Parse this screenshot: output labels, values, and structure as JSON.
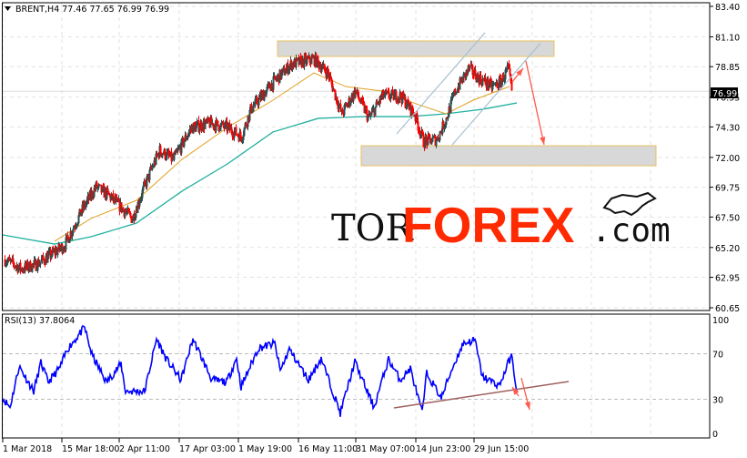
{
  "header": {
    "symbol_label": "BRENT,H4 77.46 77.65 76.99 76.99"
  },
  "rsi_header": {
    "label": "RSI(13) 37.8064"
  },
  "logo": {
    "tor": "TOR",
    "forex": "FOREX",
    "com": ".com"
  },
  "colors": {
    "bull": "#2f4f4f",
    "bear": "#ff0000",
    "ma_fast": "#e0a020",
    "ma_slow": "#20b0a0",
    "rsi": "#0000ff",
    "arrow": "#ff5a4a",
    "zone_border": "#e8c060",
    "zone_fill": "#d8d8d8",
    "channel": "#a8c0d0",
    "rsi_trend": "#a06060"
  },
  "chart_data": {
    "type": "candlestick",
    "symbol": "BRENT",
    "timeframe": "H4",
    "ohlc_last": {
      "open": 77.46,
      "high": 77.65,
      "low": 76.99,
      "close": 76.99
    },
    "current_price_label": "76.99",
    "y_ticks": [
      "83.40",
      "81.10",
      "78.85",
      "76.55",
      "74.30",
      "72.00",
      "69.75",
      "67.50",
      "65.20",
      "62.95",
      "60.65"
    ],
    "y_tick_values": [
      83.4,
      81.1,
      78.85,
      76.55,
      74.3,
      72.0,
      69.75,
      67.5,
      65.2,
      62.95,
      60.65
    ],
    "ylim": [
      60.65,
      83.4
    ],
    "x_ticks": [
      {
        "bar": 0,
        "label": "1 Mar 2018"
      },
      {
        "bar": 65,
        "label": "15 Mar 18:00"
      },
      {
        "bar": 128,
        "label": "2 Apr 11:00"
      },
      {
        "bar": 194,
        "label": "17 Apr 03:00"
      },
      {
        "bar": 259,
        "label": "1 May 19:00"
      },
      {
        "bar": 325,
        "label": "16 May 11:00"
      },
      {
        "bar": 388,
        "label": "31 May 07:00"
      },
      {
        "bar": 454,
        "label": "14 Jun 23:00"
      },
      {
        "bar": 518,
        "label": "29 Jun 15:00"
      }
    ],
    "price_path": [
      [
        2,
        64.3
      ],
      [
        20,
        63.6
      ],
      [
        37,
        63.95
      ],
      [
        67,
        65.33
      ],
      [
        87,
        68.07
      ],
      [
        102,
        69.79
      ],
      [
        117,
        69.1
      ],
      [
        142,
        67.39
      ],
      [
        157,
        70.14
      ],
      [
        172,
        72.54
      ],
      [
        187,
        71.85
      ],
      [
        207,
        74.26
      ],
      [
        227,
        74.6
      ],
      [
        247,
        74.26
      ],
      [
        262,
        73.57
      ],
      [
        272,
        75.63
      ],
      [
        297,
        77.7
      ],
      [
        317,
        79.07
      ],
      [
        342,
        79.41
      ],
      [
        357,
        78.38
      ],
      [
        372,
        75.29
      ],
      [
        387,
        77.01
      ],
      [
        402,
        74.95
      ],
      [
        417,
        76.66
      ],
      [
        437,
        76.66
      ],
      [
        452,
        75.29
      ],
      [
        462,
        73.2
      ],
      [
        477,
        73.4
      ],
      [
        487,
        74.95
      ],
      [
        497,
        77.01
      ],
      [
        512,
        78.73
      ],
      [
        522,
        78.04
      ],
      [
        537,
        77.35
      ],
      [
        547,
        77.7
      ],
      [
        555,
        78.73
      ],
      [
        559,
        76.99
      ]
    ],
    "ma_fast": [
      [
        57,
        65.67
      ],
      [
        97,
        67.39
      ],
      [
        147,
        68.76
      ],
      [
        197,
        71.85
      ],
      [
        247,
        74.26
      ],
      [
        297,
        76.32
      ],
      [
        342,
        78.38
      ],
      [
        377,
        77.35
      ],
      [
        417,
        77.01
      ],
      [
        457,
        75.98
      ],
      [
        487,
        75.29
      ],
      [
        517,
        76.32
      ],
      [
        557,
        77.35
      ]
    ],
    "ma_slow": [
      [
        0,
        66.15
      ],
      [
        57,
        65.46
      ],
      [
        97,
        66.01
      ],
      [
        147,
        67.04
      ],
      [
        197,
        69.45
      ],
      [
        247,
        71.51
      ],
      [
        297,
        73.92
      ],
      [
        347,
        74.95
      ],
      [
        397,
        75.08
      ],
      [
        447,
        75.08
      ],
      [
        487,
        75.29
      ],
      [
        527,
        75.63
      ],
      [
        565,
        76.11
      ]
    ],
    "zones": [
      {
        "from_bar": 302,
        "to_bar": 606,
        "top": 80.79,
        "bottom": 79.62
      },
      {
        "from_bar": 394,
        "to_bar": 718,
        "top": 72.88,
        "bottom": 71.37
      }
    ],
    "channel": [
      [
        [
          433,
          73.78
        ],
        [
          530,
          81.41
        ]
      ],
      [
        [
          494,
          72.95
        ],
        [
          591,
          80.62
        ]
      ]
    ],
    "arrows": [
      [
        [
          560,
          77.7
        ],
        [
          572,
          78.73
        ]
      ],
      [
        [
          575,
          79.28
        ],
        [
          595,
          72.95
        ]
      ]
    ],
    "rsi": {
      "period": 13,
      "last": 37.8064,
      "ylim": [
        0,
        100
      ],
      "levels": [
        30,
        70
      ],
      "y_ticks": [
        "100",
        "70",
        "30",
        "0"
      ],
      "y_tick_values": [
        100,
        70,
        30,
        0
      ],
      "path": [
        [
          0,
          31
        ],
        [
          8,
          23
        ],
        [
          18,
          59
        ],
        [
          34,
          37
        ],
        [
          42,
          62
        ],
        [
          50,
          45
        ],
        [
          63,
          58
        ],
        [
          71,
          74
        ],
        [
          90,
          93
        ],
        [
          98,
          69
        ],
        [
          114,
          45
        ],
        [
          130,
          61
        ],
        [
          135,
          37
        ],
        [
          156,
          37
        ],
        [
          169,
          83
        ],
        [
          180,
          65
        ],
        [
          196,
          47
        ],
        [
          209,
          83
        ],
        [
          230,
          47
        ],
        [
          246,
          45
        ],
        [
          257,
          66
        ],
        [
          262,
          41
        ],
        [
          281,
          75
        ],
        [
          299,
          79
        ],
        [
          305,
          55
        ],
        [
          315,
          74
        ],
        [
          336,
          47
        ],
        [
          350,
          66
        ],
        [
          371,
          18
        ],
        [
          387,
          63
        ],
        [
          408,
          23
        ],
        [
          424,
          65
        ],
        [
          437,
          47
        ],
        [
          448,
          57
        ],
        [
          461,
          18
        ],
        [
          466,
          53
        ],
        [
          482,
          31
        ],
        [
          493,
          55
        ],
        [
          506,
          79
        ],
        [
          519,
          82
        ],
        [
          527,
          50
        ],
        [
          546,
          42
        ],
        [
          559,
          69
        ],
        [
          565,
          38
        ]
      ],
      "trendline": [
        [
          430,
          22.4
        ],
        [
          622,
          45.6
        ]
      ],
      "arrows": [
        [
          [
            567,
            32.8
          ],
          [
            560,
            40.8
          ]
        ],
        [
          [
            570,
            48.8
          ],
          [
            579,
            20.8
          ]
        ]
      ]
    }
  }
}
